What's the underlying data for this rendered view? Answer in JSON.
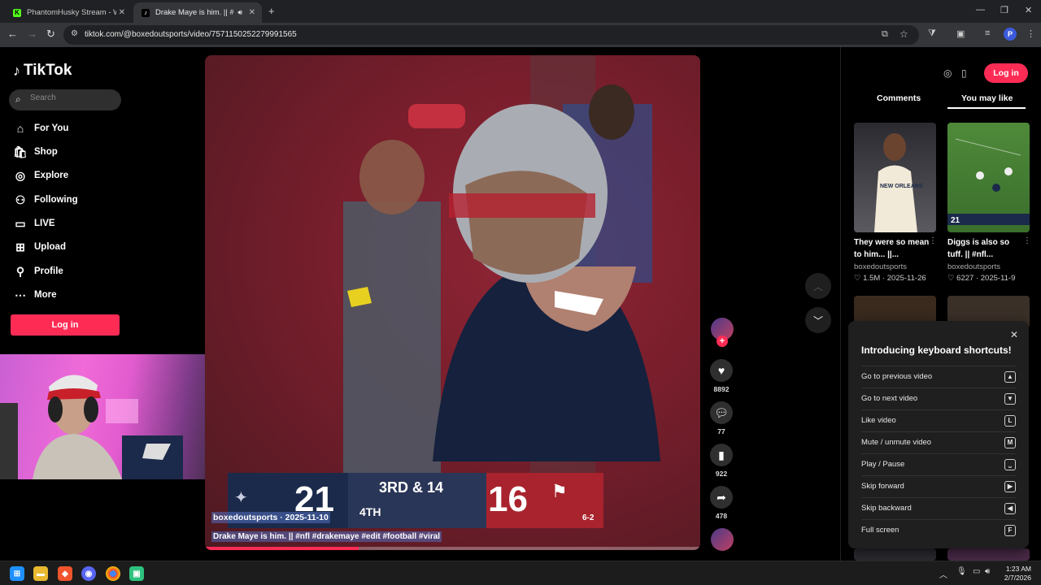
{
  "browser": {
    "tabs": [
      {
        "title": "PhantomHusky Stream - Watch",
        "favicon": "K"
      },
      {
        "title": "Drake Maye is him. || #nfl #",
        "favicon": "tiktok-icon"
      }
    ],
    "url": "tiktok.com/@boxedoutsports/video/7571150252279991565",
    "new_tab": "+",
    "profile_initial": "P"
  },
  "sidebar": {
    "logo": "TikTok",
    "search_placeholder": "Search",
    "items": [
      {
        "label": "For You",
        "icon": "home-icon"
      },
      {
        "label": "Shop",
        "icon": "shop-icon"
      },
      {
        "label": "Explore",
        "icon": "compass-icon"
      },
      {
        "label": "Following",
        "icon": "following-icon"
      },
      {
        "label": "LIVE",
        "icon": "live-icon"
      },
      {
        "label": "Upload",
        "icon": "upload-icon"
      },
      {
        "label": "Profile",
        "icon": "profile-icon"
      },
      {
        "label": "More",
        "icon": "more-icon"
      }
    ],
    "login": "Log in"
  },
  "video": {
    "scorebug": {
      "home_score": "21",
      "down": "3RD & 14",
      "quarter": "4TH",
      "away_score": "16",
      "away_record": "6-2"
    },
    "meta": "boxedoutsports · 2025-11-10",
    "description": "Drake Maye is him. || #nfl #drakemaye #edit #football #viral",
    "progress": 0.31
  },
  "actions": {
    "likes": "8892",
    "comments": "77",
    "saves": "922",
    "shares": "478"
  },
  "right": {
    "login": "Log in",
    "tabs": [
      "Comments",
      "You may like"
    ],
    "videos": [
      {
        "title": "They were so mean to him... ||...",
        "user": "boxedoutsports",
        "likes": "1.5M",
        "date": "2025-11-26"
      },
      {
        "title": "Diggs is also so tuff. || #nfl...",
        "user": "boxedoutsports",
        "likes": "6227",
        "date": "2025-11-9"
      }
    ],
    "thumb_text": [
      "NEW ORLEANS",
      "21"
    ]
  },
  "shortcuts": {
    "title": "Introducing keyboard shortcuts!",
    "rows": [
      {
        "label": "Go to previous video",
        "key": "▲"
      },
      {
        "label": "Go to next video",
        "key": "▼"
      },
      {
        "label": "Like video",
        "key": "L"
      },
      {
        "label": "Mute / unmute video",
        "key": "M"
      },
      {
        "label": "Play / Pause",
        "key": "⎵"
      },
      {
        "label": "Skip forward",
        "key": "▶"
      },
      {
        "label": "Skip backward",
        "key": "◀"
      },
      {
        "label": "Full screen",
        "key": "F"
      }
    ]
  },
  "taskbar": {
    "time": "1:23 AM",
    "date": "2/7/2026"
  }
}
